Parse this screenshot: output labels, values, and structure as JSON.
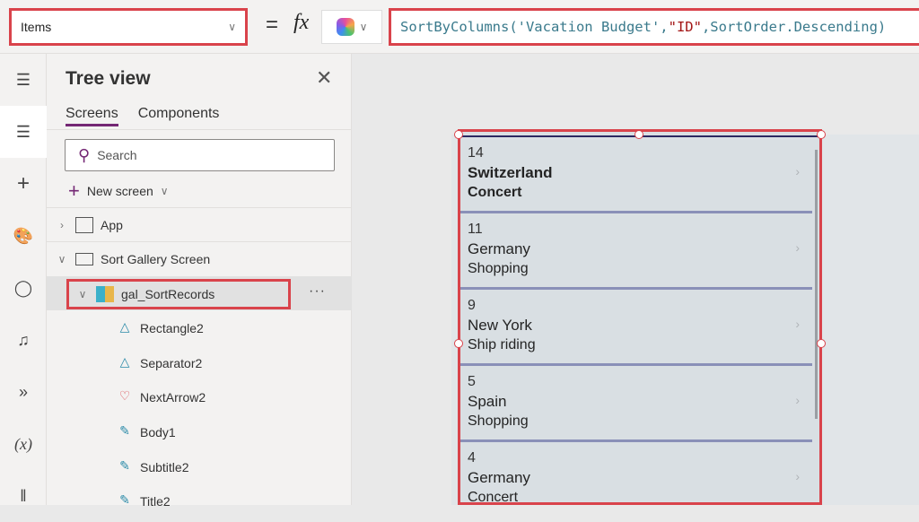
{
  "formula_bar": {
    "property": "Items",
    "equals": "=",
    "fx": "fx",
    "formula_parts": {
      "a": "SortByColumns('Vacation Budget',",
      "b": "\"ID\"",
      "c": ",SortOrder.Descending)"
    }
  },
  "rail": {
    "icons": [
      "hamburger-icon",
      "layers-icon",
      "plus-icon",
      "palette-icon",
      "database-icon",
      "media-icon",
      "power-automate-icon",
      "variables-icon",
      "tools-icon"
    ],
    "variables_label": "(x)"
  },
  "tree_view": {
    "title": "Tree view",
    "tabs": [
      "Screens",
      "Components"
    ],
    "search_placeholder": "Search",
    "new_screen": "New screen",
    "app": "App",
    "screen": "Sort Gallery Screen",
    "gallery": "gal_SortRecords",
    "more": "···",
    "children": [
      "Rectangle2",
      "Separator2",
      "NextArrow2",
      "Body1",
      "Subtitle2",
      "Title2"
    ]
  },
  "gallery": {
    "items": [
      {
        "id": "14",
        "title": "Switzerland",
        "subtitle": "Concert"
      },
      {
        "id": "11",
        "title": "Germany",
        "subtitle": "Shopping"
      },
      {
        "id": "9",
        "title": "New York",
        "subtitle": "Ship riding"
      },
      {
        "id": "5",
        "title": "Spain",
        "subtitle": "Shopping"
      },
      {
        "id": "4",
        "title": "Germany",
        "subtitle": "Concert"
      }
    ]
  }
}
